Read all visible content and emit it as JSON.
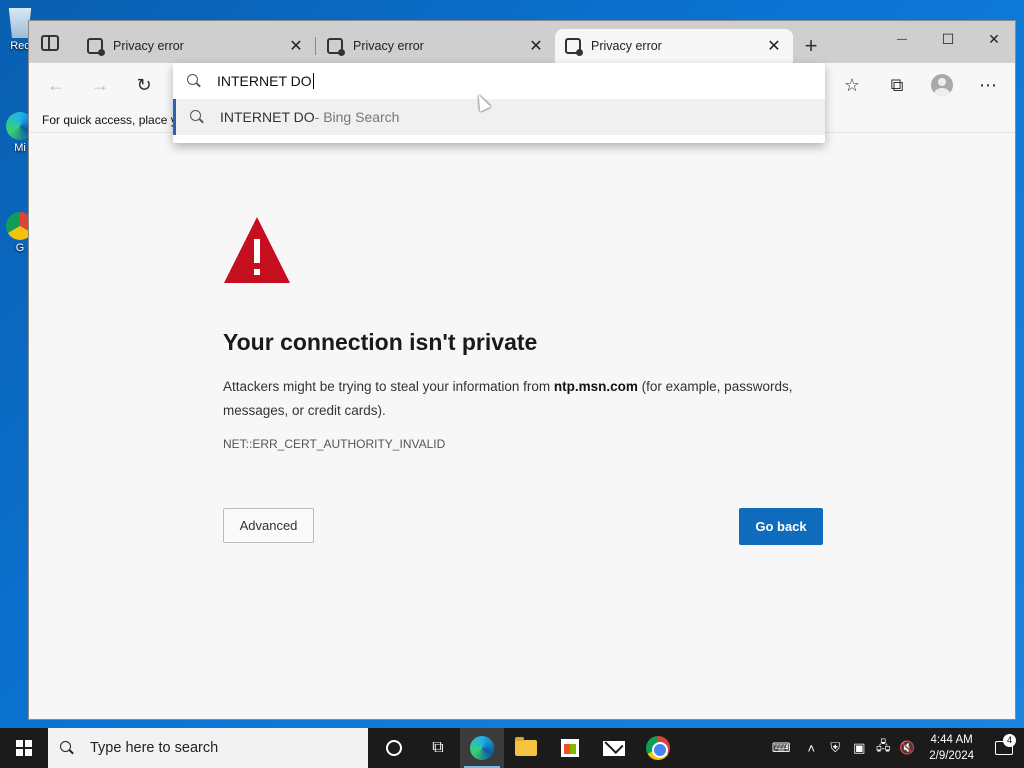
{
  "desktop": {
    "icons": [
      {
        "label": "Rec",
        "icon": "recycle-bin-icon"
      },
      {
        "label": "Mi",
        "icon": "edge-shortcut-icon"
      },
      {
        "label": "G",
        "icon": "chrome-shortcut-icon"
      }
    ]
  },
  "browser": {
    "tabs": [
      {
        "label": "Privacy error",
        "close": "✕",
        "active": false
      },
      {
        "label": "Privacy error",
        "close": "✕",
        "active": false
      },
      {
        "label": "Privacy error",
        "close": "✕",
        "active": true
      }
    ],
    "new_tab": "+",
    "window_controls": {
      "minimize": "—",
      "maximize": "☐",
      "close": "✕"
    },
    "favorites_bar_text": "For quick access, place y",
    "omnibox": {
      "query": "INTERNET DO",
      "suggestion_main": "INTERNET DO",
      "suggestion_sub": " - Bing Search"
    },
    "toolbar_icons": [
      "back-icon",
      "forward-icon",
      "refresh-icon",
      "favorites-icon",
      "collections-icon",
      "profile-icon",
      "more-icon"
    ]
  },
  "error_page": {
    "title": "Your connection isn't private",
    "body_prefix": "Attackers might be trying to steal your information from ",
    "host": "ntp.msn.com",
    "body_suffix": " (for example, passwords, messages, or credit cards).",
    "code": "NET::ERR_CERT_AUTHORITY_INVALID",
    "advanced_label": "Advanced",
    "go_back_label": "Go back",
    "warning_color": "#c50f1f",
    "primary_color": "#0f6cbd"
  },
  "taskbar": {
    "search_placeholder": "Type here to search",
    "clock_time": "4:44 AM",
    "clock_date": "2/9/2024",
    "notification_count": "4"
  }
}
